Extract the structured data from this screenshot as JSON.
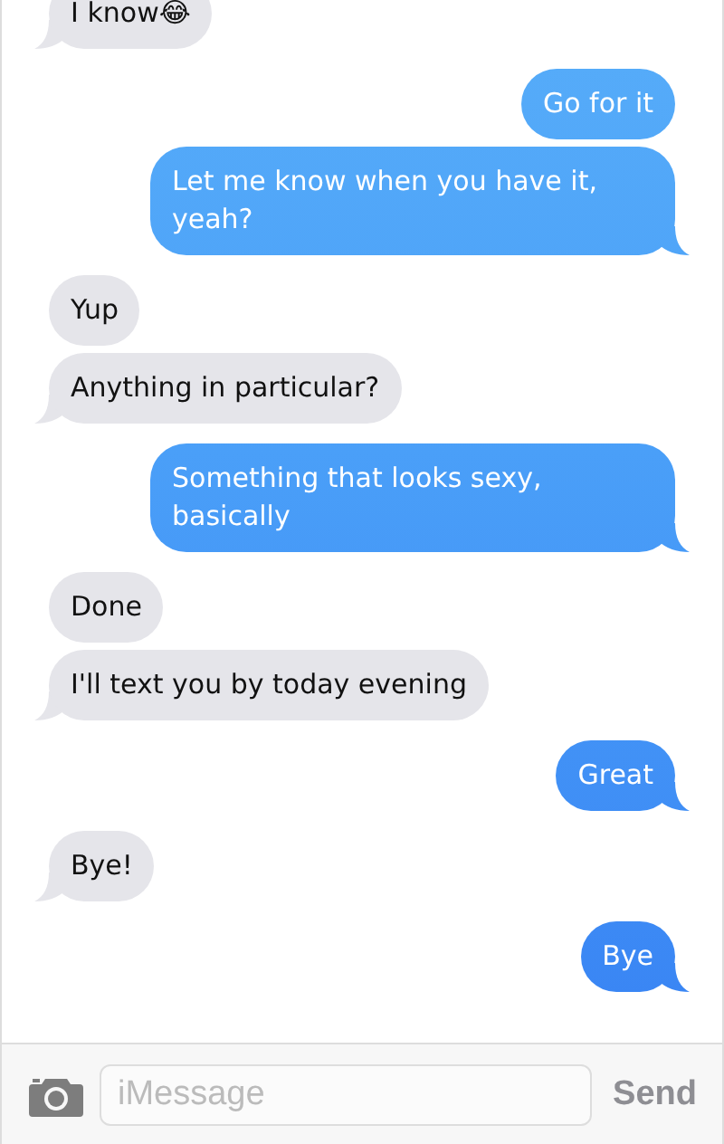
{
  "messages": [
    {
      "kind": "received",
      "text": "I know😂",
      "tail": true
    },
    {
      "kind": "sent",
      "text": "Go for it",
      "tail": false
    },
    {
      "kind": "sent",
      "text": "Let me know when you have it, yeah?",
      "tail": true
    },
    {
      "kind": "received",
      "text": "Yup",
      "tail": false
    },
    {
      "kind": "received",
      "text": "Anything in particular?",
      "tail": true
    },
    {
      "kind": "sent",
      "text": "Something that looks sexy, basically",
      "tail": true
    },
    {
      "kind": "received",
      "text": "Done",
      "tail": false
    },
    {
      "kind": "received",
      "text": "I'll text you by today evening",
      "tail": true
    },
    {
      "kind": "sent",
      "text": "Great",
      "tail": true
    },
    {
      "kind": "received",
      "text": "Bye!",
      "tail": true
    },
    {
      "kind": "sent",
      "text": "Bye",
      "tail": true
    }
  ],
  "composer": {
    "placeholder": "iMessage",
    "send": "Send"
  }
}
